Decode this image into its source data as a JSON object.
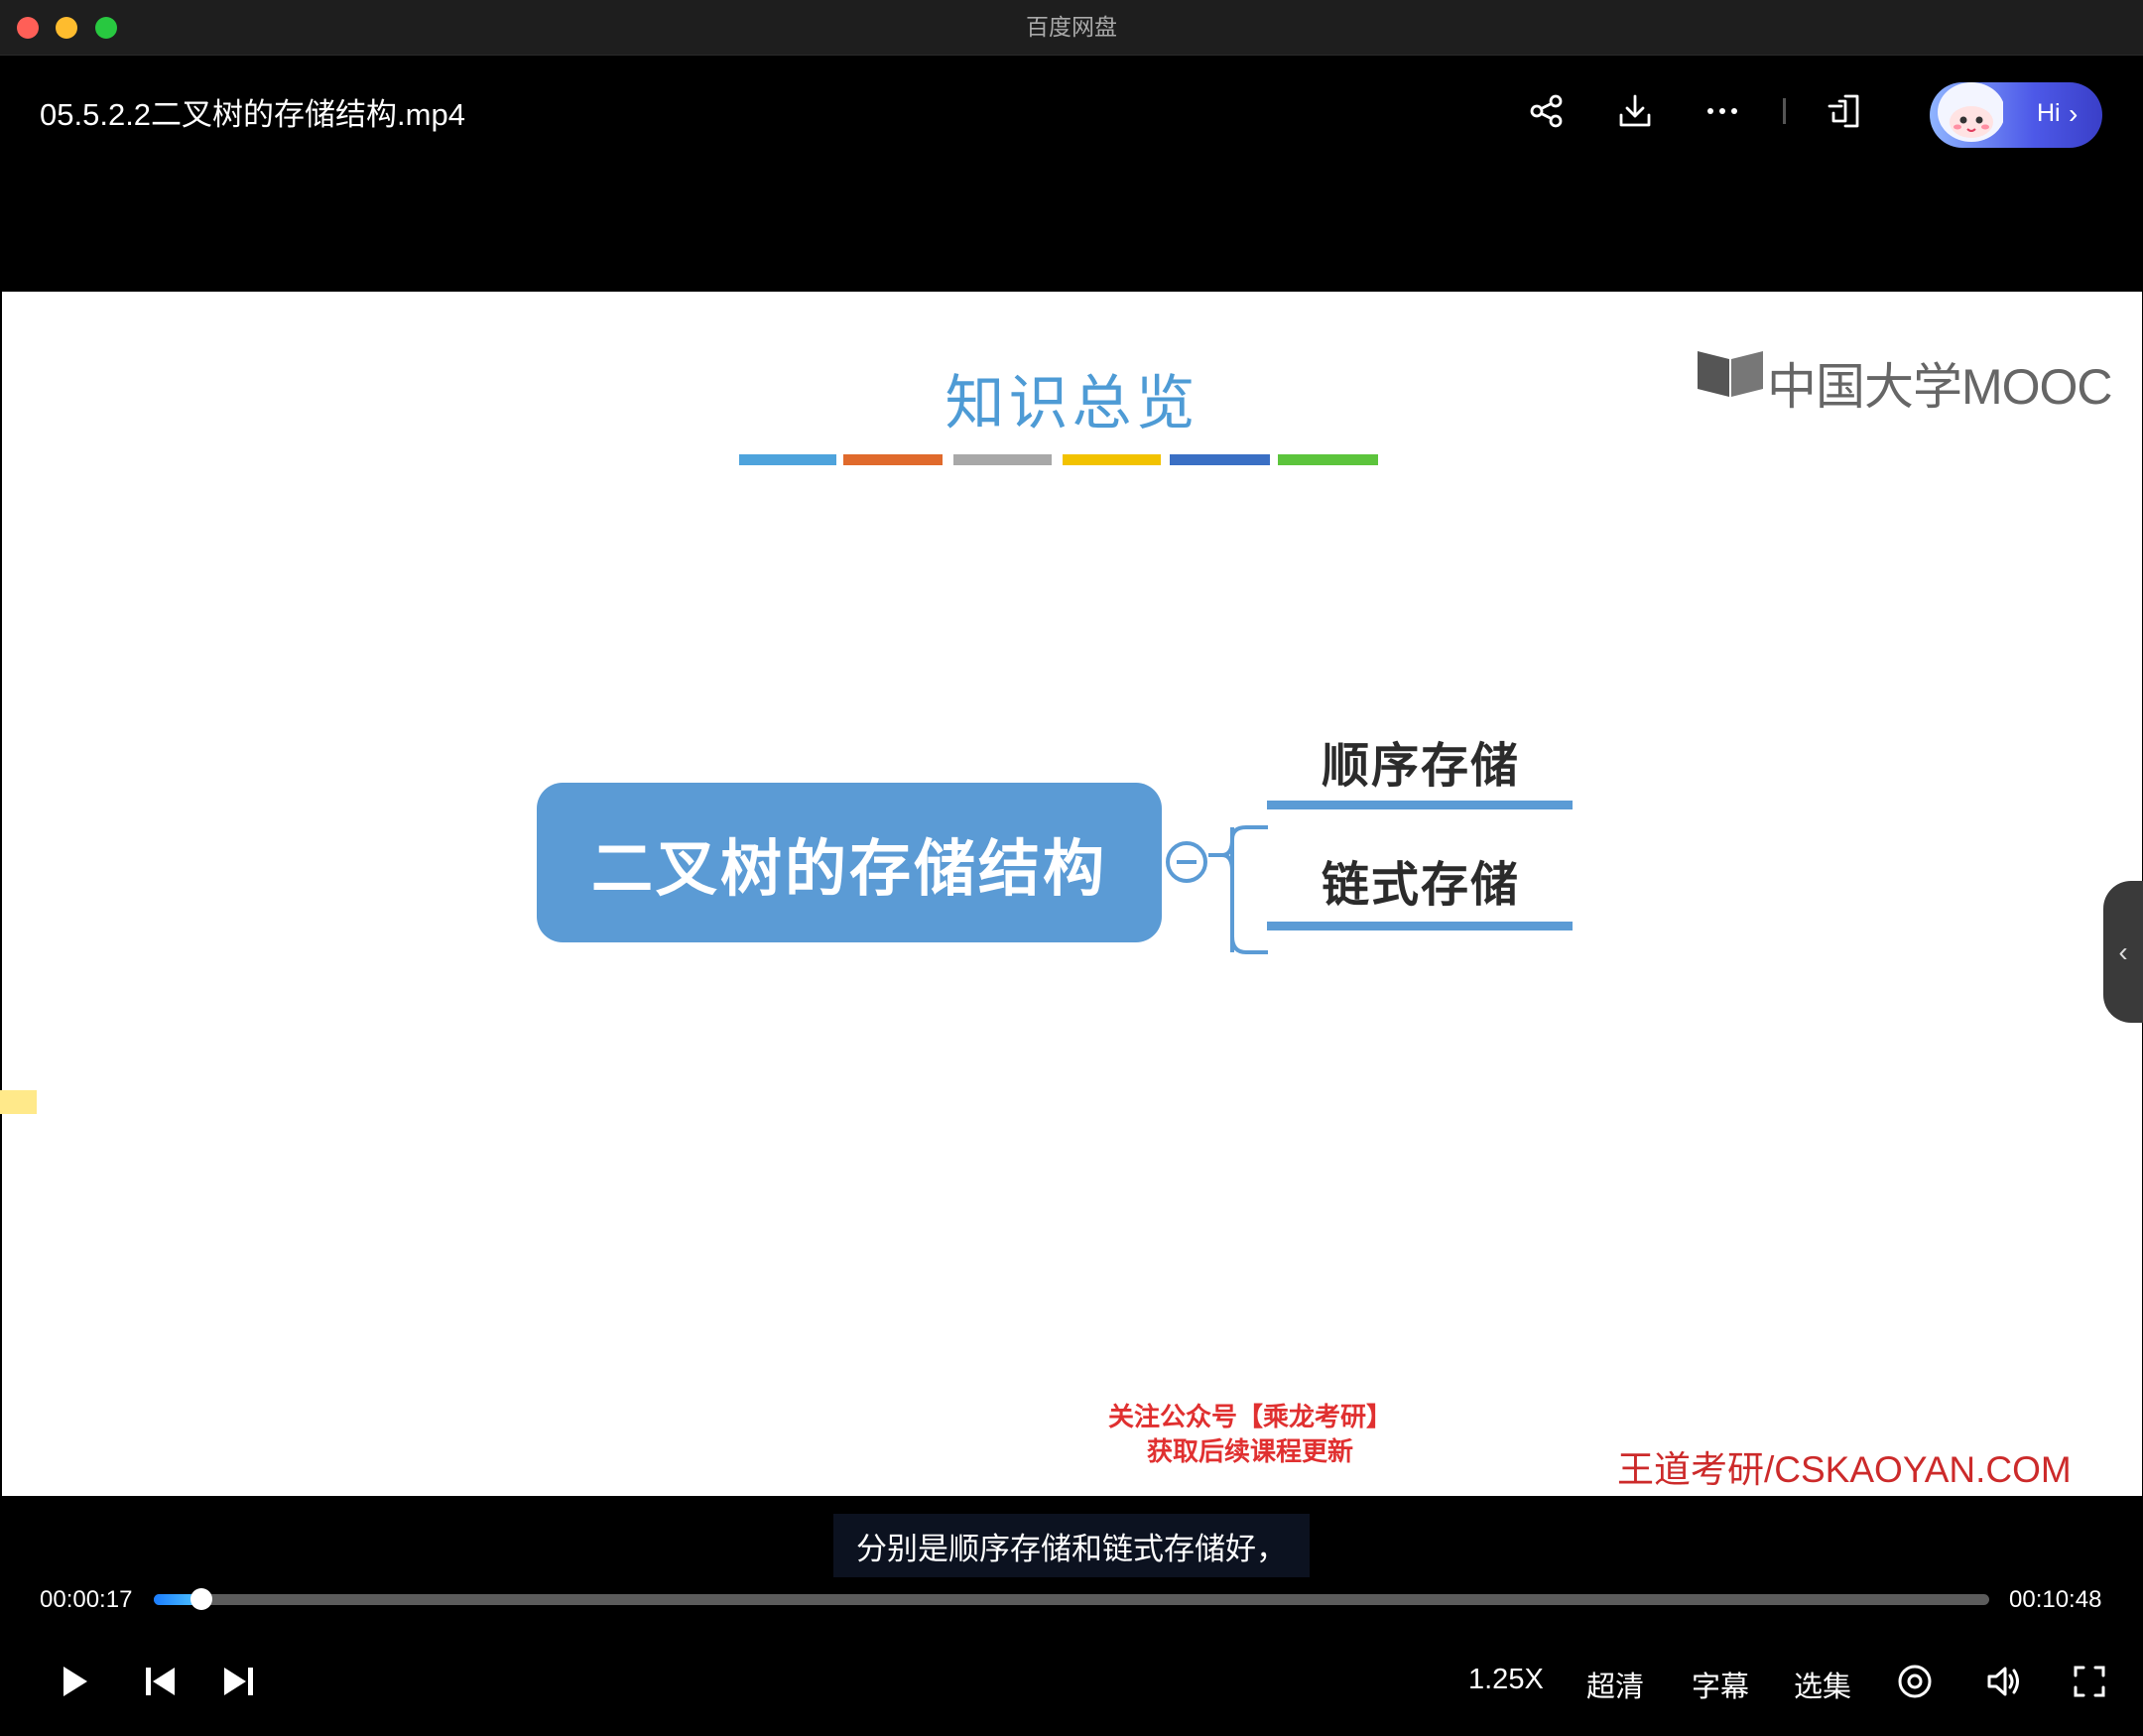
{
  "window": {
    "app_title": "百度网盘",
    "traffic_lights": {
      "close_color": "#ff5f57",
      "minimize_color": "#febc2e",
      "zoom_color": "#28c840"
    }
  },
  "header": {
    "file_title": "05.5.2.2二叉树的存储结构.mp4",
    "icons": [
      "share-icon",
      "download-icon",
      "more-icon",
      "float-window-icon"
    ],
    "assistant_label": "Hi"
  },
  "slide": {
    "title": "知识总览",
    "color_bars": [
      "#4ea3dc",
      "#e06a2c",
      "#a8a8a8",
      "#f2c200",
      "#3a6fc4",
      "#5cc43c"
    ],
    "logo_text": "中国大学MOOC",
    "mindmap": {
      "root": "二叉树的存储结构",
      "children": [
        "顺序存储",
        "链式存储"
      ]
    },
    "watermark_lines": [
      "关注公众号【乘龙考研】",
      "获取后续课程更新"
    ],
    "site": "王道考研/CSKAOYAN.COM"
  },
  "player": {
    "subtitle": "分别是顺序存储和链式存储好，",
    "current_time": "00:00:17",
    "total_time": "00:10:48",
    "progress_percent": 2.6,
    "speed": "1.25X",
    "quality": "超清",
    "captions_label": "字幕",
    "episodes_label": "选集",
    "accent_color": "#1a7cff"
  }
}
